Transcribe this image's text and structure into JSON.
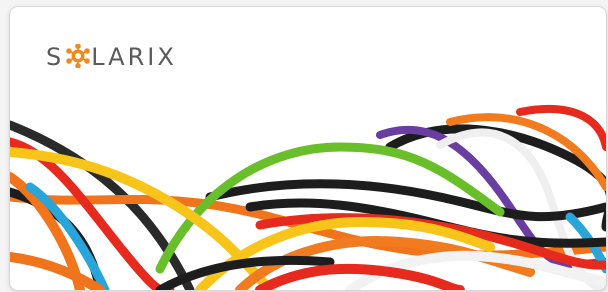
{
  "brand": {
    "name": "SOLARIX",
    "prefix": "S",
    "suffix": "LARIX",
    "accent_color": "#f08a1c",
    "text_color": "#5a5a5a",
    "icon": "sun-icon"
  },
  "banner": {
    "image": "colorful-cables-photo",
    "cable_colors": [
      "#1d1d1d",
      "#e62a1e",
      "#f7c51a",
      "#f27a1f",
      "#69bf2a",
      "#6a3da1",
      "#2aa5d9",
      "#f2f2f2"
    ]
  }
}
